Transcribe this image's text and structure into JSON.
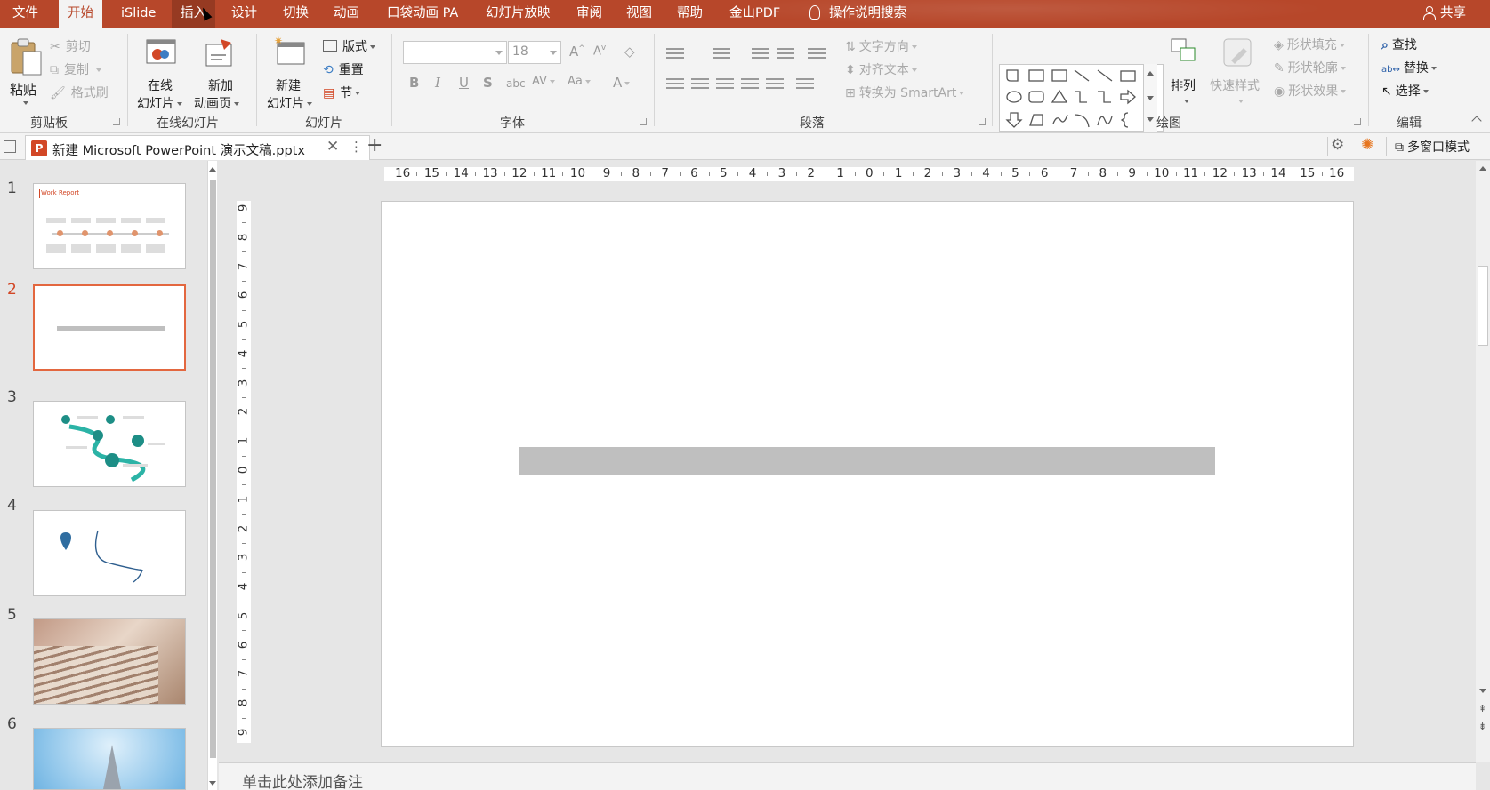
{
  "menu": {
    "items": [
      "文件",
      "开始",
      "iSlide",
      "插入",
      "设计",
      "切换",
      "动画",
      "口袋动画 PA",
      "幻灯片放映",
      "审阅",
      "视图",
      "帮助",
      "金山PDF"
    ],
    "active": "开始",
    "hovered": "插入",
    "search": "操作说明搜索",
    "share": "共享"
  },
  "ribbon": {
    "clipboard": {
      "paste": "粘贴",
      "cut": "剪切",
      "copy": "复制",
      "format_painter": "格式刷",
      "label": "剪贴板"
    },
    "online_slides": {
      "online": "在线\n幻灯片",
      "online_line1": "在线",
      "online_line2": "幻灯片",
      "new_anim_line1": "新加",
      "new_anim_line2": "动画页",
      "label": "在线幻灯片"
    },
    "slides": {
      "new_line1": "新建",
      "new_line2": "幻灯片",
      "layout": "版式",
      "reset": "重置",
      "section": "节",
      "label": "幻灯片"
    },
    "font": {
      "font_name": "",
      "font_size": "18",
      "label": "字体",
      "bold": "B",
      "italic": "I",
      "underline": "U",
      "shadow": "S",
      "strike": "abc",
      "spacing": "AV",
      "case": "Aa",
      "color": "A"
    },
    "paragraph": {
      "text_direction": "文字方向",
      "align_text": "对齐文本",
      "smartart": "转换为 SmartArt",
      "label": "段落"
    },
    "drawing": {
      "arrange": "排列",
      "quick_styles": "快速样式",
      "shape_fill": "形状填充",
      "shape_outline": "形状轮廓",
      "shape_effects": "形状效果",
      "label": "绘图"
    },
    "editing": {
      "find": "查找",
      "replace": "替换",
      "select": "选择",
      "label": "编辑"
    }
  },
  "tabstrip": {
    "doc_title": "新建 Microsoft PowerPoint 演示文稿.pptx",
    "multi_window": "多窗口模式"
  },
  "thumbnails": {
    "items": [
      {
        "num": "1",
        "title": "Work Report"
      },
      {
        "num": "2",
        "title": ""
      },
      {
        "num": "3",
        "title": ""
      },
      {
        "num": "4",
        "title": ""
      },
      {
        "num": "5",
        "title": ""
      },
      {
        "num": "6",
        "title": ""
      }
    ],
    "selected": "2"
  },
  "ruler": {
    "horizontal": [
      "16",
      "15",
      "14",
      "13",
      "12",
      "11",
      "10",
      "9",
      "8",
      "7",
      "6",
      "5",
      "4",
      "3",
      "2",
      "1",
      "0",
      "1",
      "2",
      "3",
      "4",
      "5",
      "6",
      "7",
      "8",
      "9",
      "10",
      "11",
      "12",
      "13",
      "14",
      "15",
      "16"
    ],
    "vertical": [
      "9",
      "8",
      "7",
      "6",
      "5",
      "4",
      "3",
      "2",
      "1",
      "0",
      "1",
      "2",
      "3",
      "4",
      "5",
      "6",
      "7",
      "8",
      "9"
    ]
  },
  "notes": {
    "placeholder": "单击此处添加备注"
  },
  "colors": {
    "accent": "#b7472a",
    "selection": "#e3673f",
    "slide_bar": "#bfbfbf"
  }
}
